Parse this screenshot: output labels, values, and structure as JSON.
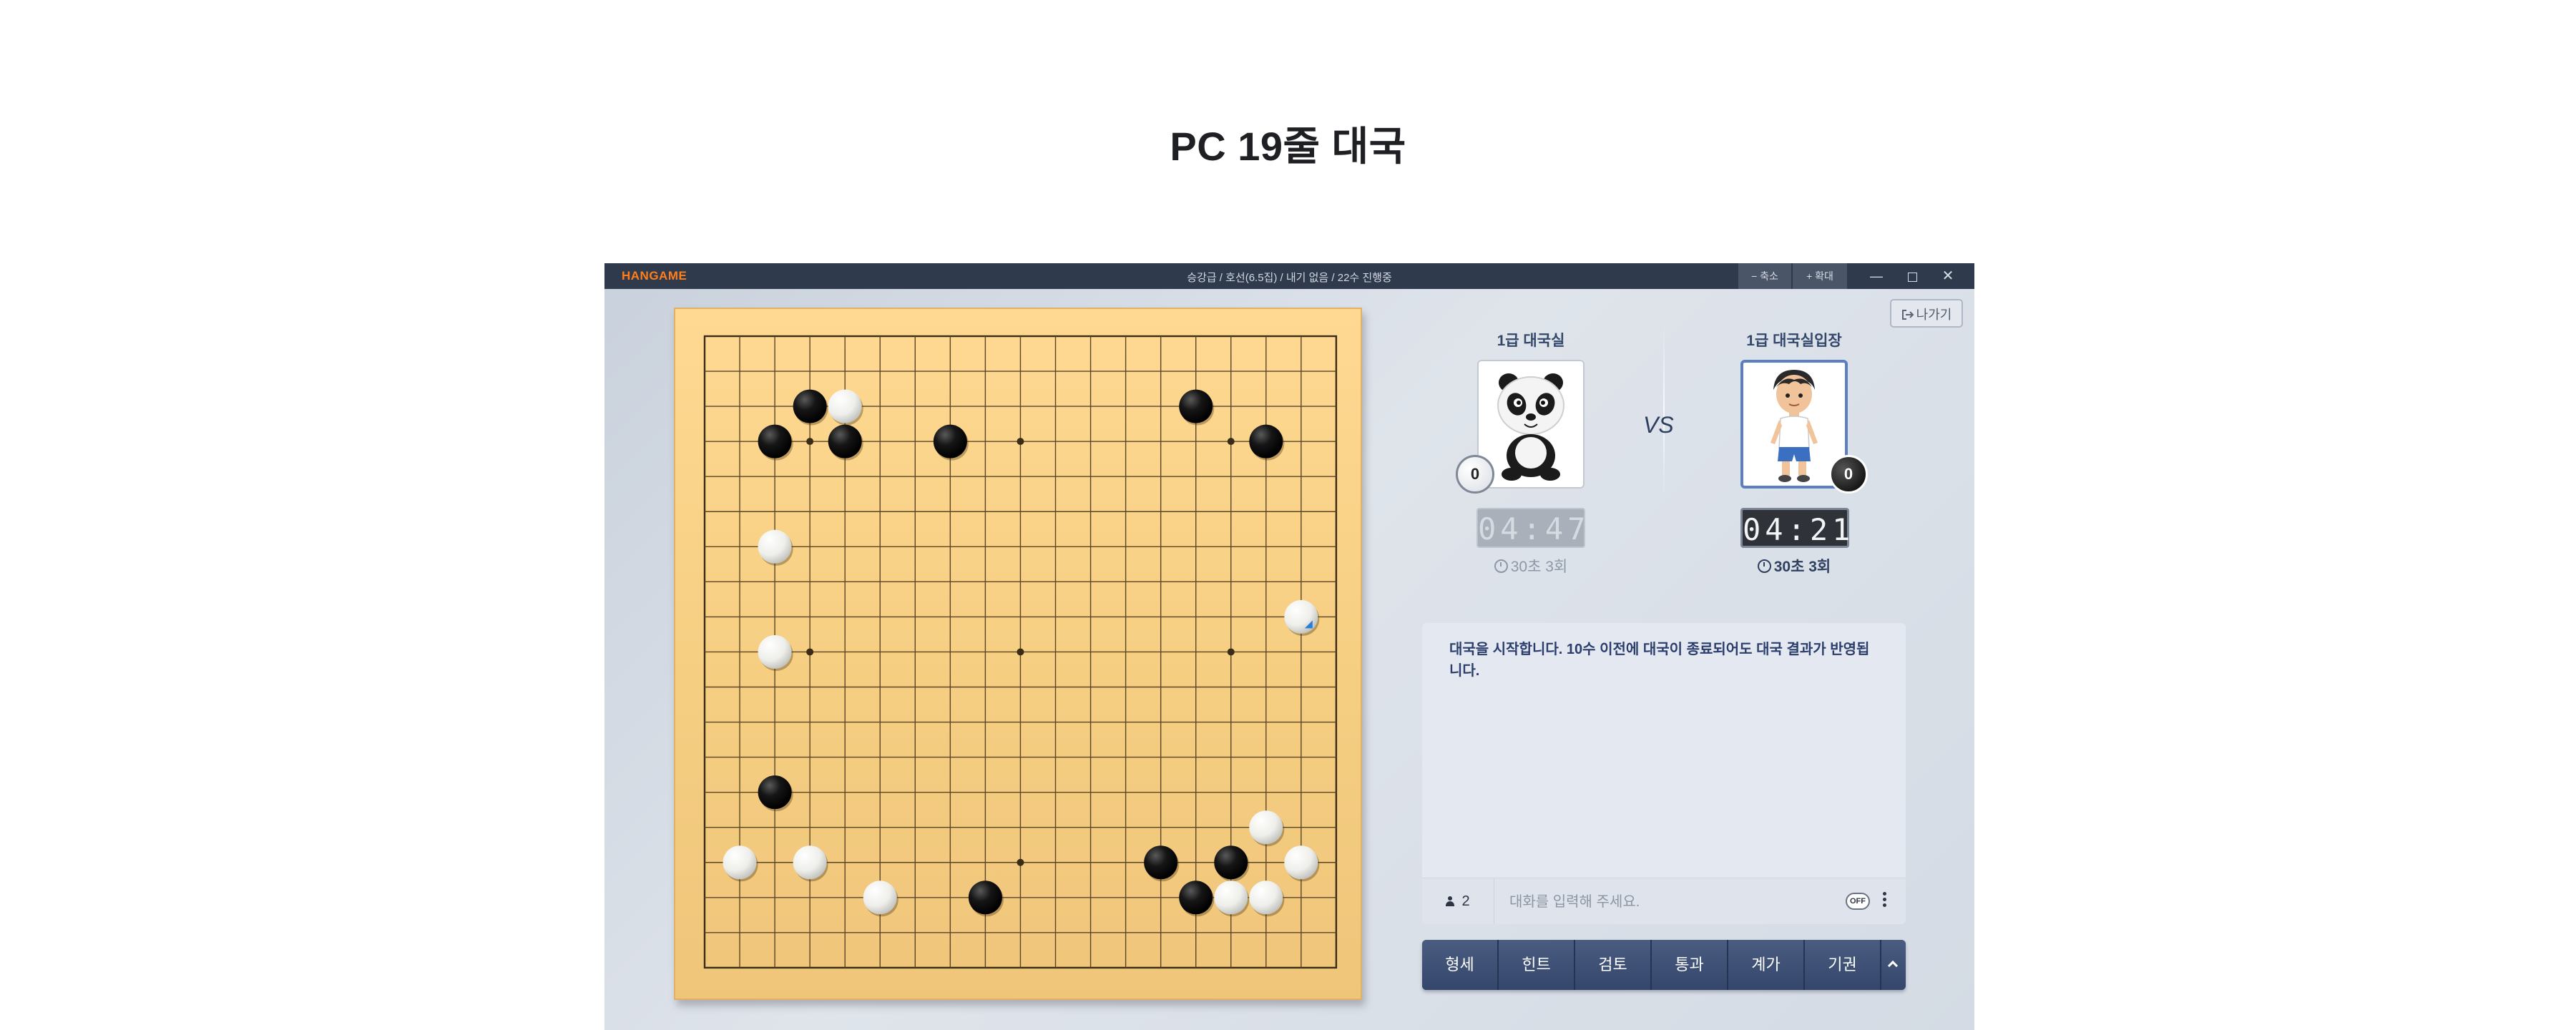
{
  "page": {
    "title": "PC 19줄 대국"
  },
  "window": {
    "logo": "HANGAME",
    "game_info": "승강급 / 호선(6.5집) / 내기 없음 / 22수 진행중",
    "shrink_label": "− 축소",
    "expand_label": "+ 확대",
    "minimize_label": "—",
    "close_label": "✕",
    "exit_label": "나가기"
  },
  "players": {
    "left": {
      "name": "1급 대국실",
      "stone": "white",
      "captures": "0",
      "time": "04:47",
      "byoyomi": "30초 3회",
      "avatar": "panda-avatar"
    },
    "right": {
      "name": "1급 대국실입장",
      "stone": "black",
      "captures": "0",
      "time": "04:21",
      "byoyomi": "30초 3회",
      "avatar": "boy-avatar"
    },
    "vs_label": "VS"
  },
  "board": {
    "size": 19,
    "stones": [
      {
        "color": "black",
        "col": 3,
        "row": 2
      },
      {
        "color": "white",
        "col": 4,
        "row": 2
      },
      {
        "color": "black",
        "col": 2,
        "row": 3
      },
      {
        "color": "black",
        "col": 4,
        "row": 3
      },
      {
        "color": "black",
        "col": 7,
        "row": 3
      },
      {
        "color": "black",
        "col": 14,
        "row": 2
      },
      {
        "color": "black",
        "col": 16,
        "row": 3
      },
      {
        "color": "white",
        "col": 2,
        "row": 6
      },
      {
        "color": "white",
        "col": 2,
        "row": 9
      },
      {
        "color": "white",
        "col": 17,
        "row": 8,
        "last_move": true
      },
      {
        "color": "black",
        "col": 2,
        "row": 13
      },
      {
        "color": "white",
        "col": 16,
        "row": 14
      },
      {
        "color": "white",
        "col": 1,
        "row": 15
      },
      {
        "color": "white",
        "col": 3,
        "row": 15
      },
      {
        "color": "black",
        "col": 13,
        "row": 15
      },
      {
        "color": "black",
        "col": 15,
        "row": 15
      },
      {
        "color": "white",
        "col": 17,
        "row": 15
      },
      {
        "color": "white",
        "col": 5,
        "row": 16
      },
      {
        "color": "black",
        "col": 8,
        "row": 16
      },
      {
        "color": "black",
        "col": 14,
        "row": 16
      },
      {
        "color": "white",
        "col": 15,
        "row": 16
      },
      {
        "color": "white",
        "col": 16,
        "row": 16
      }
    ]
  },
  "chat": {
    "message": "대국을 시작합니다. 10수 이전에 대국이 종료되어도 대국 결과가 반영됩니다.",
    "viewer_count": "2",
    "placeholder": "대화를 입력해 주세요.",
    "toggle_label": "OFF"
  },
  "actions": [
    {
      "label": "형세"
    },
    {
      "label": "힌트"
    },
    {
      "label": "검토"
    },
    {
      "label": "통과"
    },
    {
      "label": "계가"
    },
    {
      "label": "기권"
    }
  ]
}
